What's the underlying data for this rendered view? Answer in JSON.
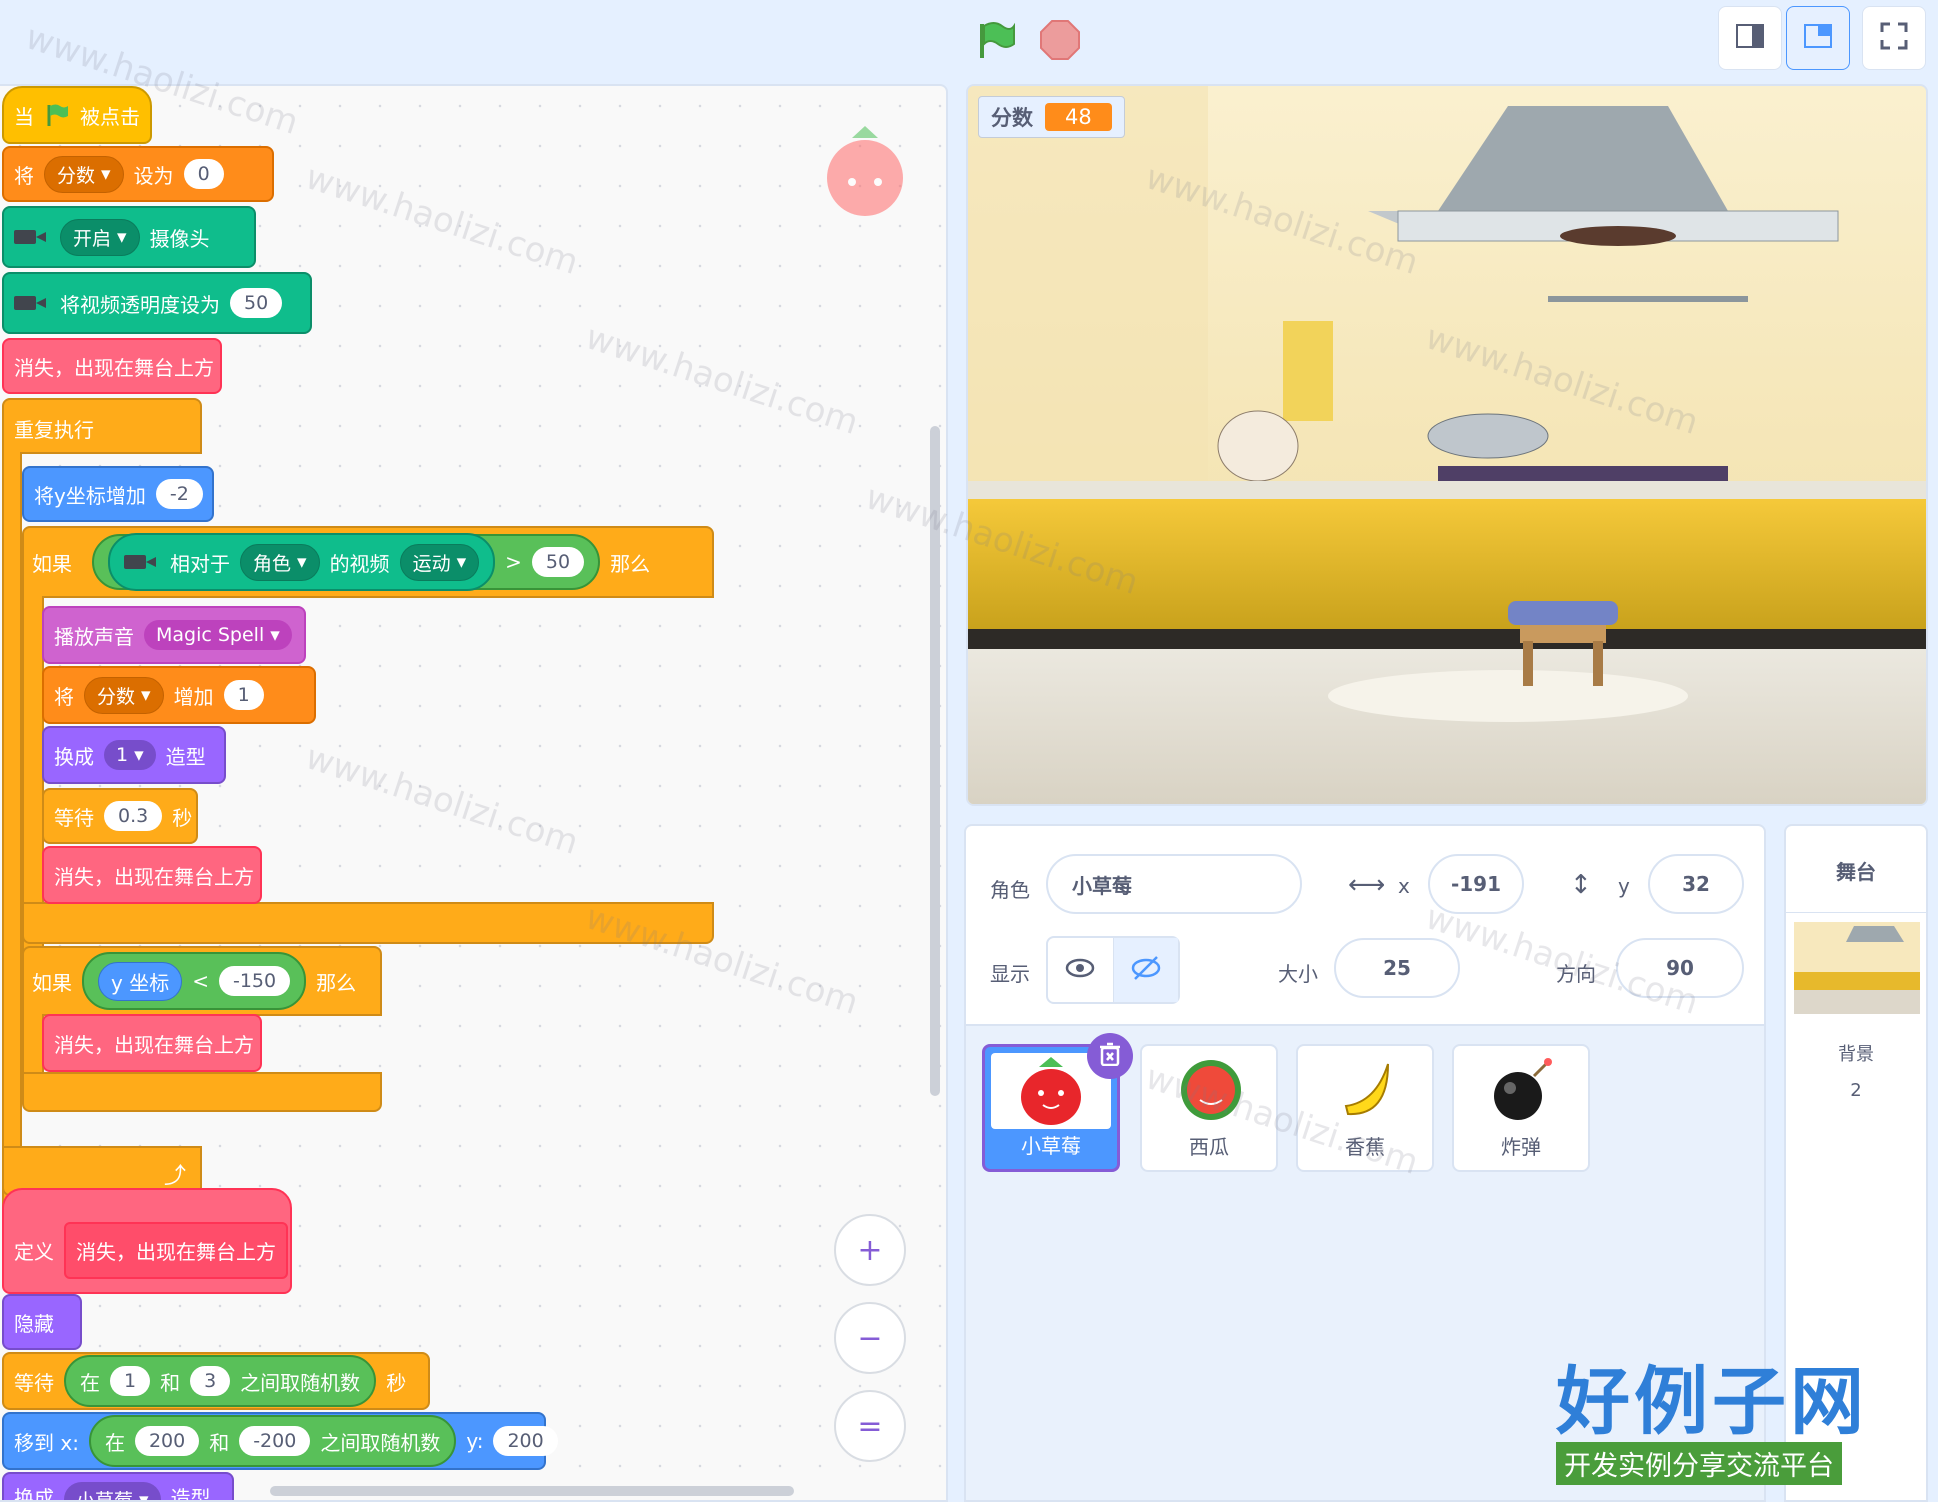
{
  "topbar": {
    "green_flag_icon": "green-flag-icon",
    "stop_icon": "stop-icon",
    "layout_buttons": [
      "small-stage-icon",
      "normal-stage-icon",
      "fullscreen-icon"
    ]
  },
  "colors": {
    "events": "#ffbf00",
    "variables": "#ff8c1a",
    "video": "#0fbd8c",
    "custom": "#ff6680",
    "control": "#ffab19",
    "motion": "#4c97ff",
    "sound": "#cf63cf",
    "looks": "#9966ff",
    "operators": "#59c059",
    "selected": "#855cd6"
  },
  "code": {
    "b1": {
      "a": "当",
      "b": "被点击"
    },
    "b2": {
      "a": "将",
      "var": "分数",
      "b": "设为",
      "val": "0"
    },
    "b3": {
      "menu": "开启",
      "b": "摄像头"
    },
    "b4": {
      "a": "将视频透明度设为",
      "val": "50"
    },
    "b5": {
      "a": "消失，出现在舞台上方"
    },
    "b6": {
      "a": "重复执行"
    },
    "b7": {
      "a": "将y坐标增加",
      "val": "-2"
    },
    "b8": {
      "a": "如果",
      "b": "相对于",
      "menu1": "角色",
      "c": "的视频",
      "menu2": "运动",
      "op": ">",
      "val": "50",
      "d": "那么"
    },
    "b9": {
      "a": "播放声音",
      "menu": "Magic Spell"
    },
    "b10": {
      "a": "将",
      "var": "分数",
      "b": "增加",
      "val": "1"
    },
    "b11": {
      "a": "换成",
      "menu": "1",
      "b": "造型"
    },
    "b12": {
      "a": "等待",
      "val": "0.3",
      "b": "秒"
    },
    "b13": {
      "a": "消失，出现在舞台上方"
    },
    "b14": {
      "a": "如果",
      "rep": "y 坐标",
      "op": "<",
      "val": "-150",
      "b": "那么"
    },
    "b15": {
      "a": "消失，出现在舞台上方"
    },
    "d1": {
      "a": "定义",
      "b": "消失，出现在舞台上方"
    },
    "d2": {
      "a": "隐藏"
    },
    "d3": {
      "a": "等待",
      "b": "在",
      "v1": "1",
      "c": "和",
      "v2": "3",
      "d": "之间取随机数",
      "e": "秒"
    },
    "d4": {
      "a": "移到 x:",
      "b": "在",
      "v1": "200",
      "c": "和",
      "v2": "-200",
      "d": "之间取随机数",
      "e": "y:",
      "v3": "200"
    },
    "d5": {
      "a": "换成",
      "menu": "小草莓",
      "b": "造型"
    }
  },
  "zoom": {
    "in": "+",
    "out": "−",
    "reset": "="
  },
  "stage": {
    "monitor_label": "分数",
    "monitor_value": "48"
  },
  "sprite_info": {
    "sprite_label": "角色",
    "sprite_name": "小草莓",
    "x_label": "x",
    "x": "-191",
    "y_label": "y",
    "y": "32",
    "show_label": "显示",
    "size_label": "大小",
    "size": "25",
    "direction_label": "方向",
    "direction": "90"
  },
  "sprites": [
    {
      "name": "小草莓",
      "icon": "strawberry-icon"
    },
    {
      "name": "西瓜",
      "icon": "watermelon-icon"
    },
    {
      "name": "香蕉",
      "icon": "banana-icon"
    },
    {
      "name": "炸弹",
      "icon": "bomb-icon"
    }
  ],
  "stage_panel": {
    "title": "舞台",
    "backdrop_label": "背景",
    "backdrop_count": "2"
  },
  "watermark": {
    "text": "www.haolizi.com",
    "logo_title": "好例子网",
    "logo_subtitle": "开发实例分享交流平台"
  }
}
